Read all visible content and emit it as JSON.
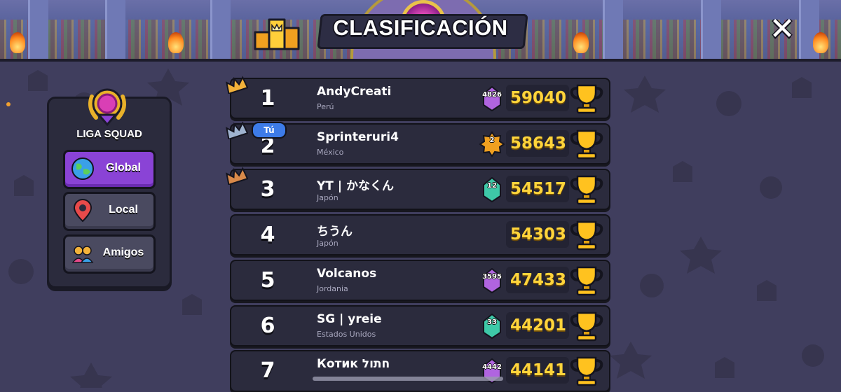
{
  "header": {
    "title": "CLASIFICACIÓN"
  },
  "league_panel": {
    "title": "LIGA SQUAD",
    "buttons": [
      {
        "label": "Global",
        "icon": "globe-icon",
        "active": true
      },
      {
        "label": "Local",
        "icon": "location-pin-icon",
        "active": false
      },
      {
        "label": "Amigos",
        "icon": "friends-icon",
        "active": false
      }
    ]
  },
  "you_badge": "Tú",
  "rows": [
    {
      "rank": "1",
      "name": "AndyCreati",
      "country": "Perú",
      "level": "4826",
      "score": "59040",
      "crown": "gold"
    },
    {
      "rank": "2",
      "name": "Sprinteruri4",
      "country": "México",
      "level": "2",
      "score": "58643",
      "crown": "silver"
    },
    {
      "rank": "3",
      "name": "YT | かなくん",
      "country": "Japón",
      "level": "12",
      "score": "54517",
      "crown": "bronze"
    },
    {
      "rank": "4",
      "name": "ちうん",
      "country": "Japón",
      "level": "",
      "score": "54303",
      "crown": ""
    },
    {
      "rank": "5",
      "name": "Volcanos",
      "country": "Jordania",
      "level": "3595",
      "score": "47433",
      "crown": ""
    },
    {
      "rank": "6",
      "name": "SG | yreie",
      "country": "Estados Unidos",
      "level": "33",
      "score": "44201",
      "crown": ""
    },
    {
      "rank": "7",
      "name": "Котик חתול",
      "country": "",
      "level": "4442",
      "score": "44141",
      "crown": ""
    }
  ],
  "colors": {
    "score": "#ffd43b",
    "active_button": "#8a43d6",
    "row_bg": "#2b2b3d",
    "you_badge": "#3d7be8",
    "crown_gold": "#f2b23a",
    "crown_silver": "#9fb3cf",
    "crown_bronze": "#d98a4a"
  }
}
